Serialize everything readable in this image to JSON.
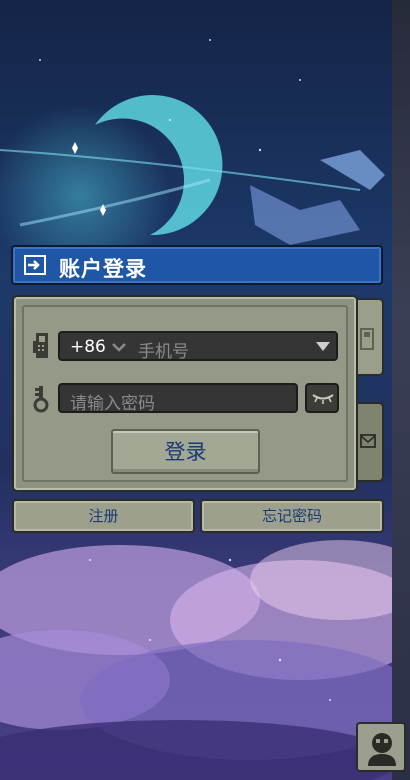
{
  "header": {
    "title": "账户登录",
    "icon": "login-icon"
  },
  "form": {
    "country_code": "+86",
    "phone_placeholder": "手机号",
    "password_placeholder": "请输入密码",
    "login_label": "登录"
  },
  "actions": {
    "register_label": "注册",
    "forgot_label": "忘记密码"
  },
  "tabs": [
    {
      "icon": "phone-icon"
    },
    {
      "icon": "mail-icon"
    }
  ],
  "colors": {
    "header_blue": "#1f56a6",
    "panel_gray": "#8e9381",
    "button_text": "#1a3a75",
    "field_dark": "#353535"
  }
}
